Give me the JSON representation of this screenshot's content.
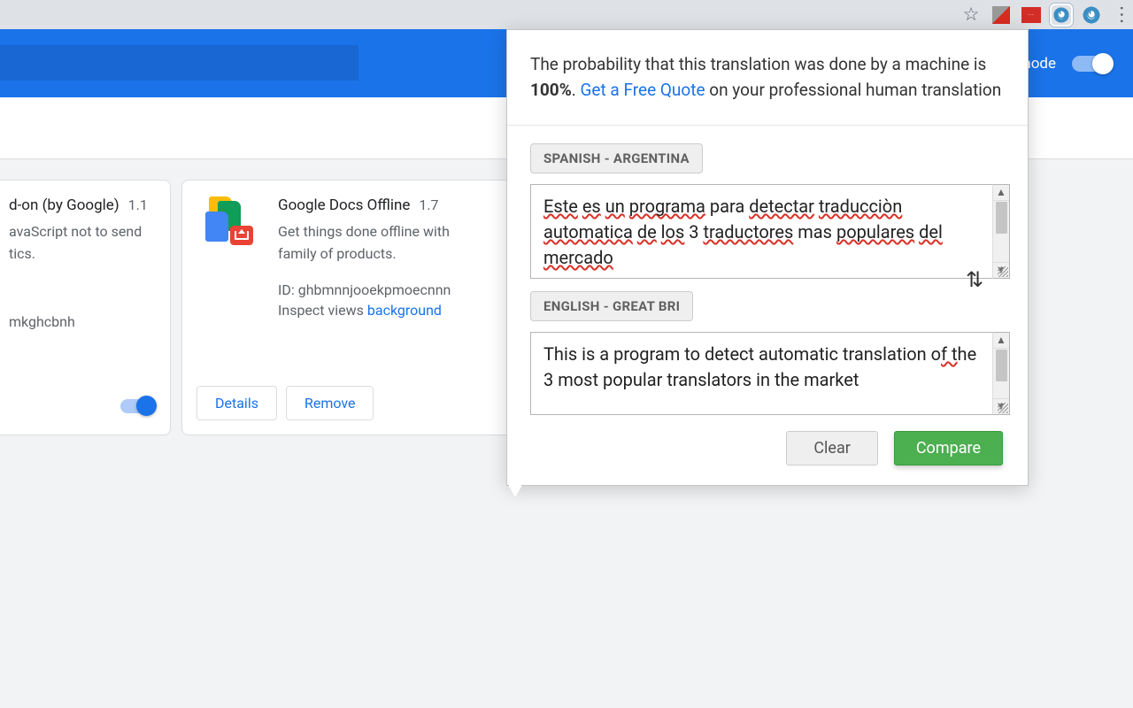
{
  "header": {
    "mode_label": "mode"
  },
  "cards": {
    "c1": {
      "title_fragment": "d-on (by Google)",
      "version": "1.1",
      "desc1": "avaScript not to send",
      "desc2": "tics.",
      "id_fragment": "mkghcbnh"
    },
    "c2": {
      "title": "Google Docs Offline",
      "version": "1.7",
      "desc": "Get things done offline with the family of products.",
      "id_label": "ID:",
      "id_value": "ghbmnnjooekpmoecnnn",
      "inspect_label": "Inspect views",
      "inspect_link": "background",
      "details": "Details",
      "remove": "Remove"
    }
  },
  "popup": {
    "msg_pre": "The probability that this translation was done by a machine is ",
    "msg_pct": "100%",
    "msg_mid": ". ",
    "msg_link": "Get a Free Quote",
    "msg_post": " on your professional human translation",
    "lang_src": "SPANISH - ARGENTINA",
    "lang_tgt": "ENGLISH - GREAT BRI",
    "src_text": "Este es un programa para detectar traducciòn automatica de los 3 traductores mas populares del mercado",
    "tgt_text": "This is a program to detect automatic translation of the 3 most popular translators in the market",
    "clear": "Clear",
    "compare": "Compare"
  }
}
